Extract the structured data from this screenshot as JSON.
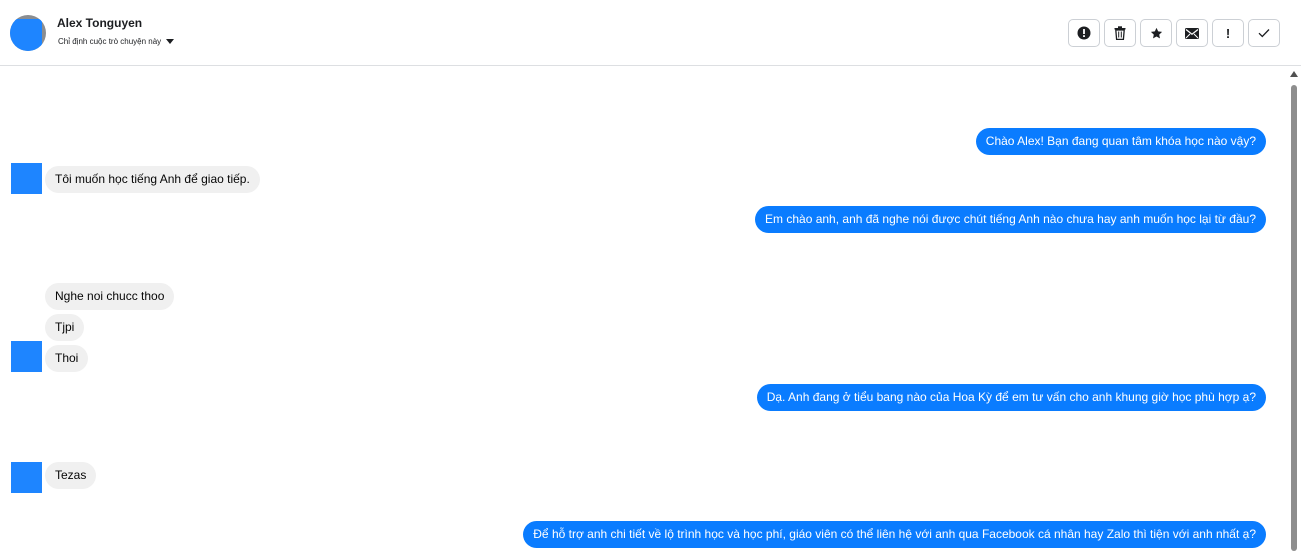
{
  "header": {
    "contact_name": "Alex Tonguyen",
    "assign_label": "Chỉ định cuộc trò chuyện này",
    "actions": [
      {
        "icon": "alert-circle-icon"
      },
      {
        "icon": "trash-icon"
      },
      {
        "icon": "star-icon"
      },
      {
        "icon": "envelope-icon"
      },
      {
        "icon": "exclamation-icon"
      },
      {
        "icon": "checkmark-icon"
      }
    ]
  },
  "messages": [
    {
      "sender": "page",
      "text": "Chào Alex! Bạn đang quan tâm khóa học nào vậy?"
    },
    {
      "sender": "user",
      "text": "Tôi muốn học tiếng Anh để giao tiếp."
    },
    {
      "sender": "page",
      "text": "Em chào anh, anh đã nghe nói được chút tiếng Anh nào chưa hay anh muốn học lại từ đầu?"
    },
    {
      "sender": "user",
      "text": "Nghe noi chucc thoo"
    },
    {
      "sender": "user",
      "text": "Tjpi"
    },
    {
      "sender": "user",
      "text": "Thoi"
    },
    {
      "sender": "page",
      "text": "Dạ. Anh đang ở tiểu bang nào của Hoa Kỳ để em tư vấn cho anh khung giờ học phù hợp ạ?"
    },
    {
      "sender": "user",
      "text": "Tezas"
    },
    {
      "sender": "page",
      "text": "Để hỗ trợ anh chi tiết về lộ trình học và học phí, giáo viên có thể liên hệ với anh qua Facebook cá nhân hay Zalo thì tiện với anh nhất ạ?"
    }
  ],
  "colors": {
    "outgoing_bubble": "#0a7cff",
    "incoming_bubble": "#f0f0f0",
    "avatar_placeholder": "#1e85ff"
  }
}
